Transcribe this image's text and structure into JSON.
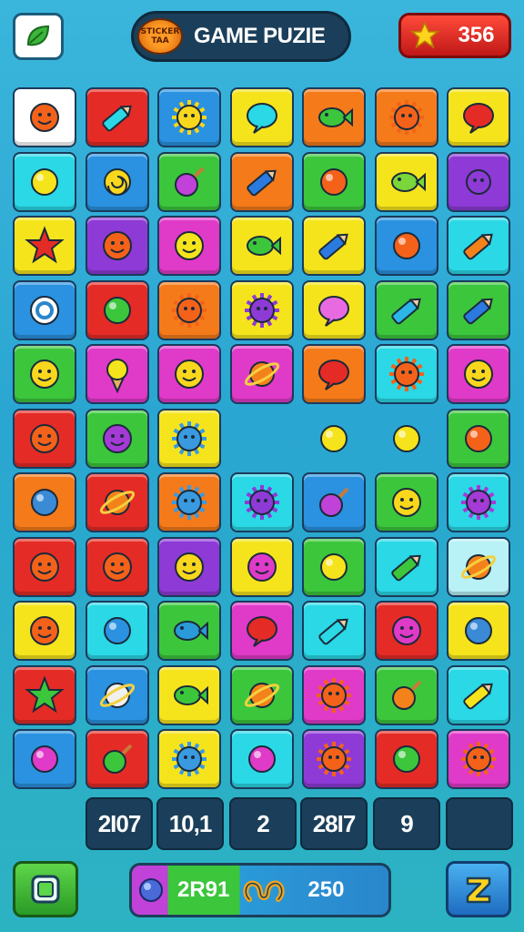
{
  "header": {
    "title": "GAME PUZIE",
    "logo_text": "STICKER TAA",
    "score": "356",
    "score_icon": "star-icon",
    "left_button_icon": "leaf-icon"
  },
  "colors": {
    "red": "#e52b26",
    "orange": "#f47a1a",
    "yellow": "#f5e41c",
    "green": "#3cc63c",
    "cyan": "#2ad8e6",
    "blue": "#2a92e0",
    "purple": "#8e3ad6",
    "magenta": "#e03ac8",
    "lightcyan": "#b8f2f6",
    "white": "#ffffff"
  },
  "board": {
    "rows": [
      [
        {
          "bg": "white",
          "icon": "orange-face"
        },
        {
          "bg": "red",
          "icon": "popsicle"
        },
        {
          "bg": "blue",
          "icon": "sun"
        },
        {
          "bg": "yellow",
          "icon": "cyan-bubble"
        },
        {
          "bg": "orange",
          "icon": "green-fish"
        },
        {
          "bg": "orange",
          "icon": "orange-spiky"
        },
        {
          "bg": "yellow",
          "icon": "red-bubble"
        }
      ],
      [
        {
          "bg": "cyan",
          "icon": "yellow-ball"
        },
        {
          "bg": "blue",
          "icon": "yellow-spiral"
        },
        {
          "bg": "green",
          "icon": "purple-lollipop"
        },
        {
          "bg": "orange",
          "icon": "blue-crayon"
        },
        {
          "bg": "green",
          "icon": "orange-ball"
        },
        {
          "bg": "yellow",
          "icon": "green-bird"
        },
        {
          "bg": "purple",
          "icon": "purple-bug"
        }
      ],
      [
        {
          "bg": "yellow",
          "icon": "red-star"
        },
        {
          "bg": "purple",
          "icon": "orange-face"
        },
        {
          "bg": "magenta",
          "icon": "yellow-monster"
        },
        {
          "bg": "yellow",
          "icon": "green-fish"
        },
        {
          "bg": "yellow",
          "icon": "blue-crayon"
        },
        {
          "bg": "blue",
          "icon": "orange-ball"
        },
        {
          "bg": "cyan",
          "icon": "carrot"
        }
      ],
      [
        {
          "bg": "blue",
          "icon": "swirl-coin"
        },
        {
          "bg": "red",
          "icon": "green-orb"
        },
        {
          "bg": "orange",
          "icon": "orange-spiky"
        },
        {
          "bg": "yellow",
          "icon": "purple-bug"
        },
        {
          "bg": "yellow",
          "icon": "magenta-bubble"
        },
        {
          "bg": "green",
          "icon": "blue-bandage"
        },
        {
          "bg": "green",
          "icon": "blue-crayon"
        }
      ],
      [
        {
          "bg": "green",
          "icon": "yellow-face"
        },
        {
          "bg": "magenta",
          "icon": "ice-cream"
        },
        {
          "bg": "magenta",
          "icon": "yellow-chick"
        },
        {
          "bg": "magenta",
          "icon": "orange-ring"
        },
        {
          "bg": "orange",
          "icon": "red-bubble"
        },
        {
          "bg": "cyan",
          "icon": "orange-spiky"
        },
        {
          "bg": "magenta",
          "icon": "yellow-face"
        }
      ],
      [
        {
          "bg": "red",
          "icon": "orange-face"
        },
        {
          "bg": "green",
          "icon": "purple-face"
        },
        {
          "bg": "yellow",
          "icon": "blue-spiky"
        },
        {
          "bg": "empty",
          "icon": ""
        },
        {
          "bg": "empty",
          "icon": "yellow-ball"
        },
        {
          "bg": "empty",
          "icon": "yellow-ball"
        },
        {
          "bg": "green",
          "icon": "orange-ball"
        }
      ],
      [
        {
          "bg": "orange",
          "icon": "blue-orb"
        },
        {
          "bg": "red",
          "icon": "orange-ring"
        },
        {
          "bg": "orange",
          "icon": "blue-spiky"
        },
        {
          "bg": "cyan",
          "icon": "purple-bug"
        },
        {
          "bg": "blue",
          "icon": "purple-lollipop"
        },
        {
          "bg": "green",
          "icon": "yellow-face"
        },
        {
          "bg": "cyan",
          "icon": "purple-spiky"
        }
      ],
      [
        {
          "bg": "red",
          "icon": "orange-face"
        },
        {
          "bg": "red",
          "icon": "orange-face"
        },
        {
          "bg": "purple",
          "icon": "yellow-face"
        },
        {
          "bg": "yellow",
          "icon": "magenta-face"
        },
        {
          "bg": "green",
          "icon": "yellow-ball"
        },
        {
          "bg": "cyan",
          "icon": "green-crayon"
        },
        {
          "bg": "lightcyan",
          "icon": "orange-ring"
        }
      ],
      [
        {
          "bg": "yellow",
          "icon": "orange-face"
        },
        {
          "bg": "cyan",
          "icon": "blue-ball"
        },
        {
          "bg": "green",
          "icon": "blue-bug"
        },
        {
          "bg": "magenta",
          "icon": "red-bubble"
        },
        {
          "bg": "cyan",
          "icon": "popsicle"
        },
        {
          "bg": "red",
          "icon": "magenta-face"
        },
        {
          "bg": "yellow",
          "icon": "blue-orb"
        }
      ],
      [
        {
          "bg": "red",
          "icon": "green-star"
        },
        {
          "bg": "blue",
          "icon": "white-ring"
        },
        {
          "bg": "yellow",
          "icon": "green-fish"
        },
        {
          "bg": "green",
          "icon": "orange-ring"
        },
        {
          "bg": "magenta",
          "icon": "orange-spiky"
        },
        {
          "bg": "green",
          "icon": "orange-lollipop"
        },
        {
          "bg": "cyan",
          "icon": "yellow-crayon"
        }
      ],
      [
        {
          "bg": "blue",
          "icon": "magenta-ball"
        },
        {
          "bg": "red",
          "icon": "green-lollipop"
        },
        {
          "bg": "yellow",
          "icon": "blue-spiky"
        },
        {
          "bg": "cyan",
          "icon": "magenta-ball"
        },
        {
          "bg": "purple",
          "icon": "orange-spiky"
        },
        {
          "bg": "red",
          "icon": "green-orb"
        },
        {
          "bg": "magenta",
          "icon": "orange-spiky"
        }
      ]
    ]
  },
  "stats": [
    "2I07",
    "10,1",
    "2",
    "28I7",
    "9",
    ""
  ],
  "footer": {
    "left_button_icon": "square-icon",
    "pill_icon": "gem-icon",
    "pill_value_left": "2R91",
    "pill_value_right": "250",
    "pill_mid_icon": "pretzel-icon",
    "right_button_icon": "z-logo-icon"
  }
}
